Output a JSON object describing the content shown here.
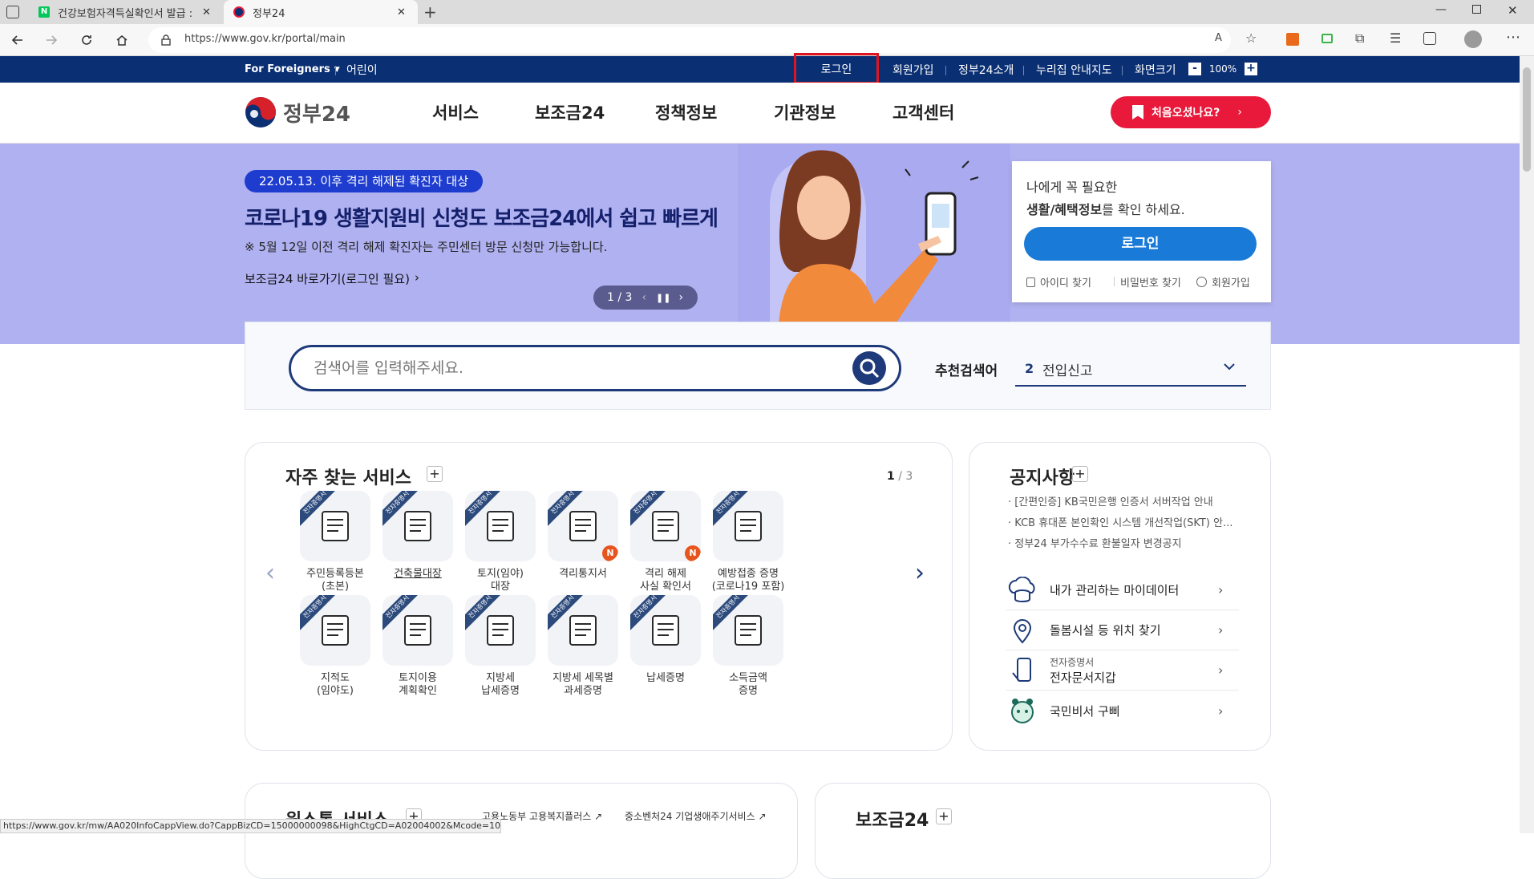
{
  "browser": {
    "tabs": [
      {
        "title": "건강보험자격득실확인서 발급 : 네"
      },
      {
        "title": "정부24"
      }
    ],
    "url": "https://www.gov.kr/portal/main",
    "status_url": "https://www.gov.kr/mw/AA020InfoCappView.do?CappBizCD=15000000098&HighCtgCD=A02004002&Mcode=10205"
  },
  "util_bar": {
    "for_foreigners": "For Foreigners",
    "kids": "어린이",
    "login": "로그인",
    "signup": "회원가입",
    "about": "정부24소개",
    "guide": "누리집 안내지도",
    "screen_size": "화면크기",
    "zoom": "100%",
    "minus": "-",
    "plus": "+"
  },
  "header": {
    "logo_text": "정부24",
    "menu": [
      "서비스",
      "보조금24",
      "정책정보",
      "기관정보",
      "고객센터"
    ],
    "first_visit": "처음오셨나요?"
  },
  "banner": {
    "badge": "22.05.13. 이후 격리 해제된 확진자 대상",
    "headline": "코로나19 생활지원비 신청도 보조금24에서 쉽고 빠르게",
    "note": "※ 5월 12일 이전 격리 해제 확진자는 주민센터 방문 신청만 가능합니다.",
    "link": "보조금24 바로가기(로그인 필요)",
    "pager": "1 / 3"
  },
  "login_box": {
    "line1": "나에게 꼭 필요한",
    "line2_bold": "생활/혜택정보",
    "line2_rest": "를 확인 하세요.",
    "button": "로그인",
    "find_id": "아이디 찾기",
    "find_pw": "비밀번호 찾기",
    "signup": "회원가입"
  },
  "search": {
    "placeholder": "검색어를 입력해주세요.",
    "recommend_label": "추천검색어",
    "recommend_rank": "2",
    "recommend_term": "전입신고"
  },
  "services": {
    "title": "자주 찾는 서비스",
    "page_current": "1",
    "page_total": " / 3",
    "ribbon": "전자증명서",
    "new_badge": "N",
    "items": [
      {
        "label1": "주민등록등본",
        "label2": "(초본)"
      },
      {
        "label1": "건축물대장",
        "label2": ""
      },
      {
        "label1": "토지(임야)",
        "label2": "대장"
      },
      {
        "label1": "격리통지서",
        "label2": ""
      },
      {
        "label1": "격리 해제",
        "label2": "사실 확인서"
      },
      {
        "label1": "예방접종 증명",
        "label2": "(코로나19 포함)"
      },
      {
        "label1": "지적도",
        "label2": "(임야도)"
      },
      {
        "label1": "토지이용",
        "label2": "계획확인"
      },
      {
        "label1": "지방세",
        "label2": "납세증명"
      },
      {
        "label1": "지방세 세목별",
        "label2": "과세증명"
      },
      {
        "label1": "납세증명",
        "label2": ""
      },
      {
        "label1": "소득금액",
        "label2": "증명"
      }
    ]
  },
  "notice": {
    "title": "공지사항",
    "items": [
      "[간편인증] KB국민은행 인증서 서버작업 안내",
      "KCB 휴대폰 본인확인 시스템 개선작업(SKT) 안...",
      "정부24 부가수수료 환불일자 변경공지"
    ],
    "links": [
      {
        "label": "내가 관리하는 마이데이터",
        "sub": ""
      },
      {
        "label": "돌봄시설 등 위치 찾기",
        "sub": ""
      },
      {
        "label": "전자문서지갑",
        "sub": "전자증명서"
      },
      {
        "label": "국민비서 구삐",
        "sub": ""
      }
    ]
  },
  "bottom": {
    "onestop_title": "원스톱 서비스",
    "onestop_link1": "고용노동부 고용복지플러스",
    "onestop_link2": "중소벤처24 기업생애주기서비스",
    "subsidy_title": "보조금24"
  },
  "colors": {
    "navy": "#0a2f73",
    "accent_red": "#e8193a",
    "banner_bg": "#b0b1f0",
    "login_blue": "#1a7ad8"
  }
}
